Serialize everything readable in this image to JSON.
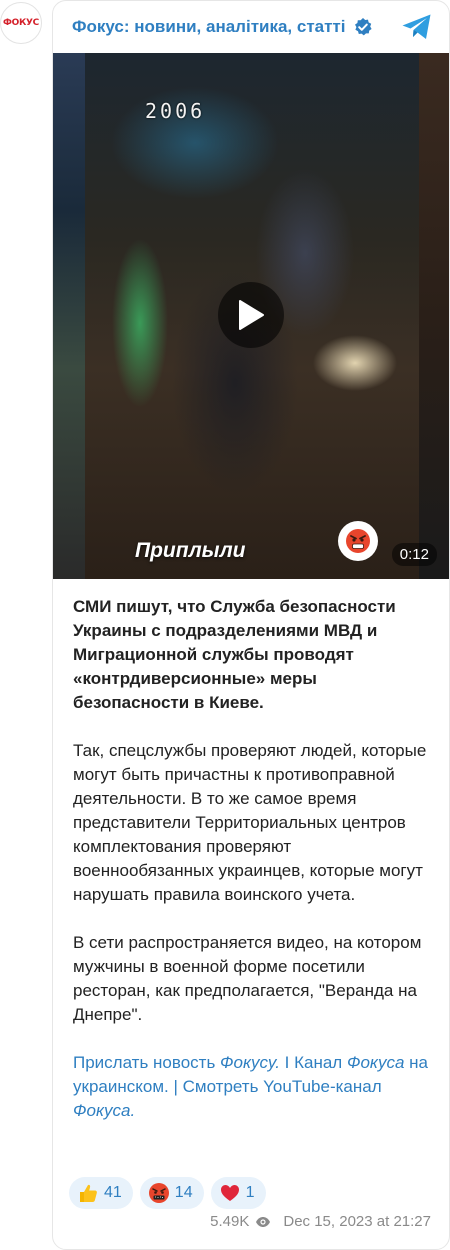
{
  "channel": {
    "avatar_text": "ФОКУС",
    "name": "Фокус: новини, аналітика, статті"
  },
  "video": {
    "timestamp_overlay": "2006",
    "caption": "Приплыли",
    "duration": "0:12",
    "reaction_emoji": "angry-face"
  },
  "post": {
    "paragraph_1": "СМИ пишут, что Служба безопасности Украины с подразделениями МВД и Миграционной службы проводят «контрдиверсионные» меры безопасности в Киеве.",
    "paragraph_2": "Так, спецслужбы проверяют людей, которые могут быть причастны к противоправной деятельности. В то же самое время представители Территориальных центров комплектования проверяют военнообязанных украинцев, которые могут нарушать правила воинского учета.",
    "paragraph_3": "В сети распространяется видео, на котором мужчины в военной форме посетили ресторан, как предполагается, \"Веранда на Днепре\".",
    "links": {
      "l1": "Прислать новость ",
      "l1_it": "Фокусу.",
      "sep1": " I ",
      "l2": "Канал ",
      "l2_it": "Фокуса",
      "l2_end": " на украинском.",
      "sep2": " | ",
      "l3": "Смотреть YouTube-канал ",
      "l3_it": "Фокуса."
    }
  },
  "reactions": [
    {
      "emoji": "thumbs-up",
      "count": "41"
    },
    {
      "emoji": "cursing-face",
      "count": "14"
    },
    {
      "emoji": "red-heart",
      "count": "1"
    }
  ],
  "footer": {
    "views": "5.49K",
    "datetime": "Dec 15, 2023 at 21:27"
  },
  "colors": {
    "link": "#2f7fc1",
    "reaction_bg": "#e8f2fb",
    "brand_red": "#d4202a"
  }
}
